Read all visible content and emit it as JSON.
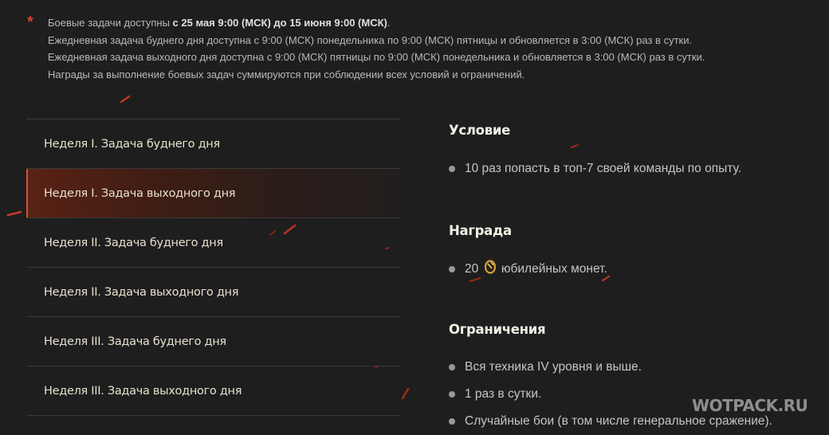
{
  "notes": {
    "asterisk": "*",
    "line1_prefix": "Боевые задачи доступны ",
    "line1_bold": "с 25 мая 9:00 (МСК) до 15 июня 9:00 (МСК)",
    "line1_suffix": ".",
    "line2": "Ежедневная задача буднего дня доступна с 9:00 (МСК) понедельника по 9:00 (МСК) пятницы и обновляется в 3:00 (МСК) раз в сутки.",
    "line3": "Ежедневная задача выходного дня доступна с 9:00 (МСК) пятницы по 9:00 (МСК) понедельника и обновляется в 3:00 (МСК) раз в сутки.",
    "line4": "Награды за выполнение боевых задач суммируются при соблюдении всех условий и ограничений."
  },
  "tabs": [
    {
      "label": "Неделя I. Задача буднего дня",
      "active": false
    },
    {
      "label": "Неделя I. Задача выходного дня",
      "active": true
    },
    {
      "label": "Неделя II. Задача буднего дня",
      "active": false
    },
    {
      "label": "Неделя II. Задача выходного дня",
      "active": false
    },
    {
      "label": "Неделя III. Задача буднего дня",
      "active": false
    },
    {
      "label": "Неделя III. Задача выходного дня",
      "active": false
    }
  ],
  "detail": {
    "condition_title": "Условие",
    "condition_items": [
      "10 раз попасть в топ-7 своей команды по опыту."
    ],
    "reward_title": "Награда",
    "reward_amount": "20",
    "reward_text": "юбилейных монет.",
    "reward_icon": "coin-icon",
    "limits_title": "Ограничения",
    "limits_items": [
      "Вся техника IV уровня и выше.",
      "1 раз в сутки.",
      "Случайные бои (в том числе генеральное сражение)."
    ]
  },
  "watermark": "WOTPACK.RU",
  "colors": {
    "background": "#1e1e1f",
    "accent": "#c9562f",
    "asterisk": "#d4412b",
    "tab_text": "#e7e1cd"
  }
}
